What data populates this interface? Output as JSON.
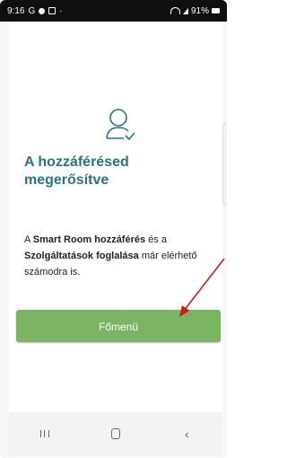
{
  "status_bar": {
    "time": "9:16",
    "carrier_letter": "G",
    "battery_text": "91%"
  },
  "screen": {
    "title": "A hozzáférésed megerősítve",
    "body": {
      "part1": "A ",
      "bold1": "Smart Room hozzáférés",
      "part2": " és a ",
      "bold2": "Szolgáltatások foglalása",
      "part3": " már elérhető számodra is."
    },
    "main_button_label": "Főmenü"
  },
  "nav_bar": {
    "back_glyph": "‹"
  },
  "colors": {
    "accent": "#24758a",
    "button": "#79b563",
    "annotation_arrow": "#e01010"
  }
}
